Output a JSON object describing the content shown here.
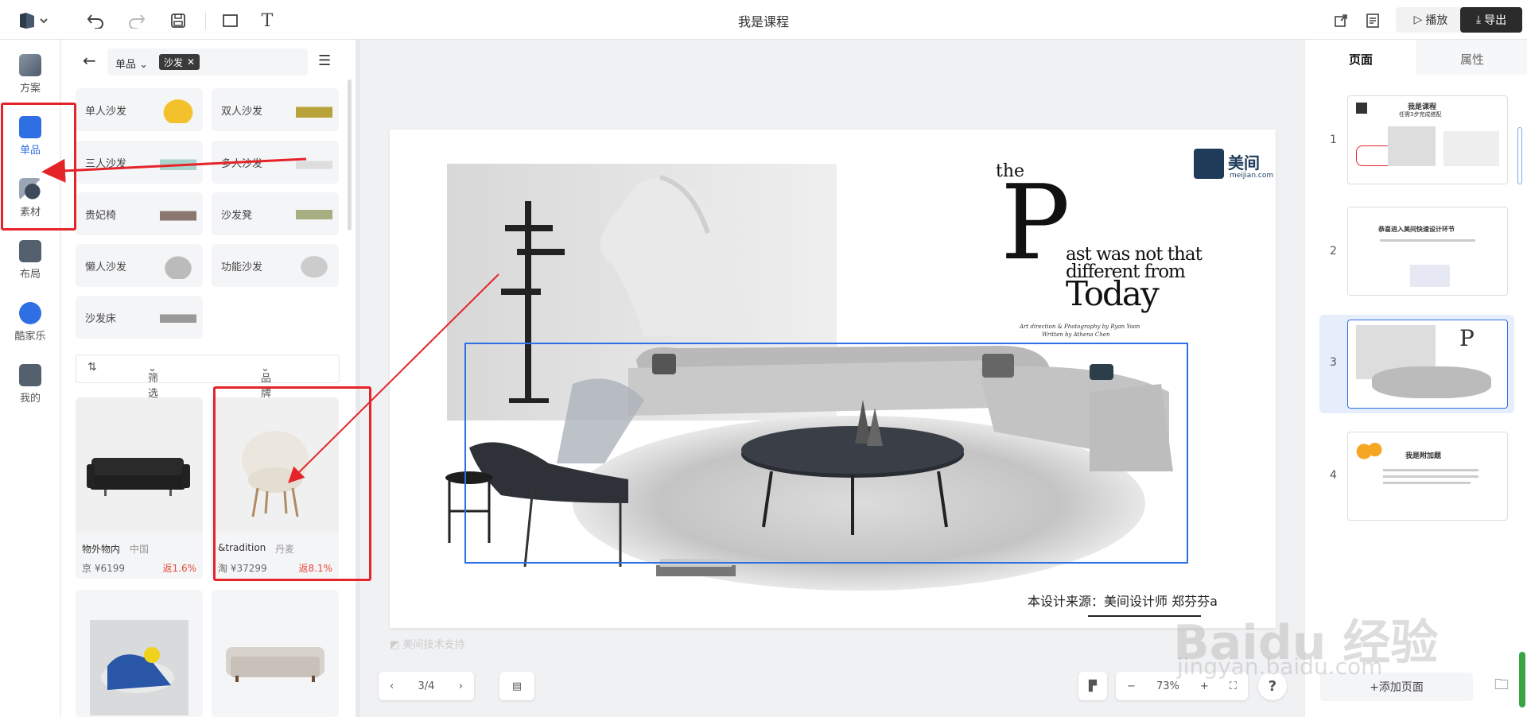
{
  "topbar": {
    "title": "我是课程",
    "play_label": "播放",
    "export_label": "导出",
    "icons": [
      "logo-icon",
      "undo-icon",
      "redo-icon",
      "save-icon",
      "rectangle-icon",
      "text-icon",
      "share-icon",
      "notes-icon"
    ]
  },
  "leftnav": {
    "items": [
      {
        "label": "方案",
        "icon": "scheme-icon"
      },
      {
        "label": "单品",
        "icon": "furniture-icon"
      },
      {
        "label": "素材",
        "icon": "material-icon"
      },
      {
        "label": "布局",
        "icon": "layout-icon"
      },
      {
        "label": "酷家乐",
        "icon": "kujiale-icon"
      },
      {
        "label": "我的",
        "icon": "user-icon"
      }
    ],
    "active": "单品"
  },
  "panel": {
    "category_select": "单品",
    "tag": "沙发",
    "categories": [
      "单人沙发",
      "双人沙发",
      "三人沙发",
      "多人沙发",
      "贵妃椅",
      "沙发凳",
      "懒人沙发",
      "功能沙发",
      "沙发床"
    ],
    "filter_label": "筛选",
    "brand_label": "品牌",
    "products": [
      {
        "brand": "物外物内",
        "origin": "中国",
        "price": "京 ¥6199",
        "rebate": "返1.6%"
      },
      {
        "brand": "&tradition",
        "origin": "丹麦",
        "price": "淘 ¥37299",
        "rebate": "返8.1%"
      },
      {
        "brand": "",
        "origin": "",
        "price": "",
        "rebate": ""
      },
      {
        "brand": "",
        "origin": "",
        "price": "",
        "rebate": ""
      }
    ]
  },
  "slide": {
    "brand_cn": "美间",
    "brand_url": "meijian.com",
    "the": "the",
    "big_letter": "P",
    "line1": "ast was not that",
    "line2": "different from",
    "line3": "Today",
    "credit1": "Art direction & Photography by Ryan Yoon",
    "credit2": "Written by Athena Chen",
    "footer_credit": "本设计来源：美间设计师 郑芬芬a",
    "watermark": "美间技术支持"
  },
  "bottom": {
    "page_indicator": "3/4",
    "zoom": "73%",
    "help": "?"
  },
  "rightpanel": {
    "tab_pages": "页面",
    "tab_props": "属性",
    "thumbs": [
      {
        "num": "1",
        "title": "我是课程",
        "subtitle": "任需3步完成搭配"
      },
      {
        "num": "2",
        "title": "恭喜进入美间快速设计环节",
        "subtitle": ""
      },
      {
        "num": "3",
        "title": "",
        "subtitle": ""
      },
      {
        "num": "4",
        "title": "我是附加题",
        "subtitle": ""
      }
    ],
    "add_page": "+添加页面"
  },
  "watermark": {
    "site": "jingyan.baidu.com",
    "text": "Baidu 经验"
  }
}
